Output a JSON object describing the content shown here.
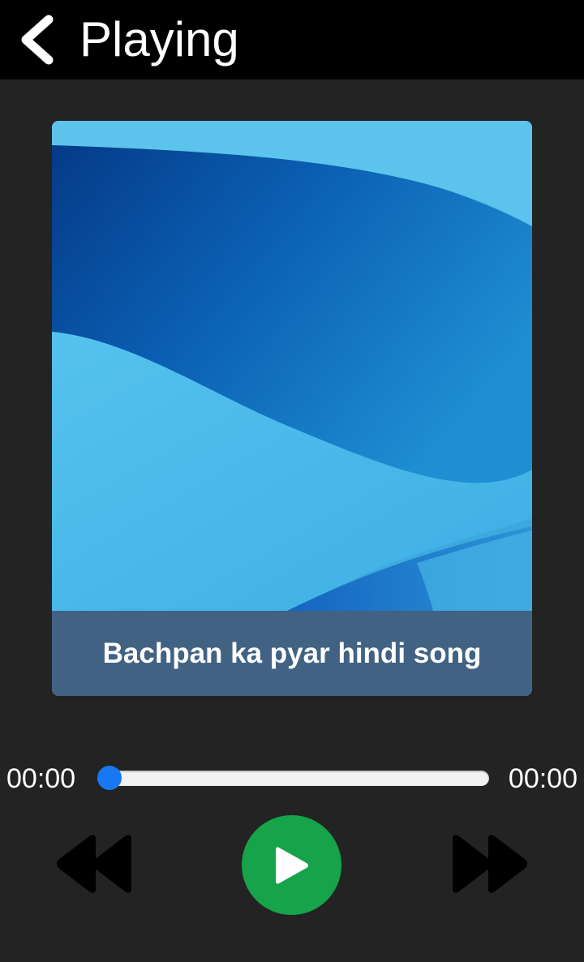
{
  "header": {
    "title": "Playing",
    "back_icon": "chevron-left-icon"
  },
  "now_playing": {
    "song_title": "Bachpan ka pyar hindi song",
    "album_art": "abstract-blue-waves-image"
  },
  "player": {
    "elapsed": "00:00",
    "total": "00:00",
    "progress": 0,
    "controls": {
      "rewind_icon": "rewind-icon",
      "play_icon": "play-icon",
      "forward_icon": "fast-forward-icon"
    }
  },
  "colors": {
    "background": "#232323",
    "header": "#000000",
    "caption_bar": "#416283",
    "seek_accent": "#1877f2",
    "play_button": "#16a34a"
  }
}
